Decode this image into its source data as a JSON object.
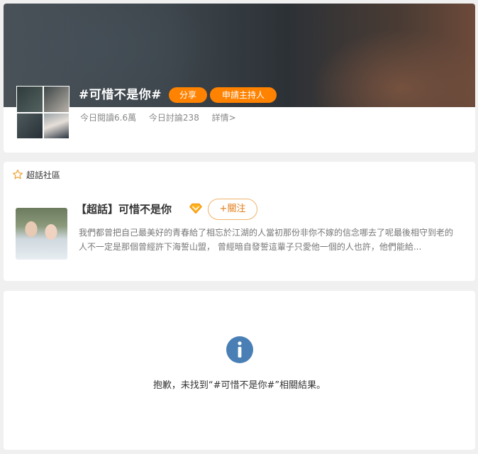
{
  "topic": {
    "title": "#可惜不是你#",
    "share_label": "分享",
    "apply_host_label": "申請主持人",
    "reads_today": "今日閱讀6.6萬",
    "discussions_today": "今日討論238",
    "details_link": "詳情>"
  },
  "super_topic_section": {
    "heading": "超話社區",
    "name": "【超話】可惜不是你",
    "follow_label": "+關注",
    "description": "我們都曾把自己最美好的青春給了相忘於江湖的人當初那份非你不嫁的信念哪去了呢最後相守到老的人不一定是那個曾經許下海誓山盟， 曾經暗自發誓這輩子只愛他一個的人也許，他們能給..."
  },
  "empty_state": {
    "message": "抱歉，未找到“#可惜不是你#”相關結果。",
    "icon": "info-icon"
  },
  "colors": {
    "accent_orange": "#ff8200",
    "info_blue": "#4a7fb5",
    "page_bg": "#f0f0f0"
  }
}
